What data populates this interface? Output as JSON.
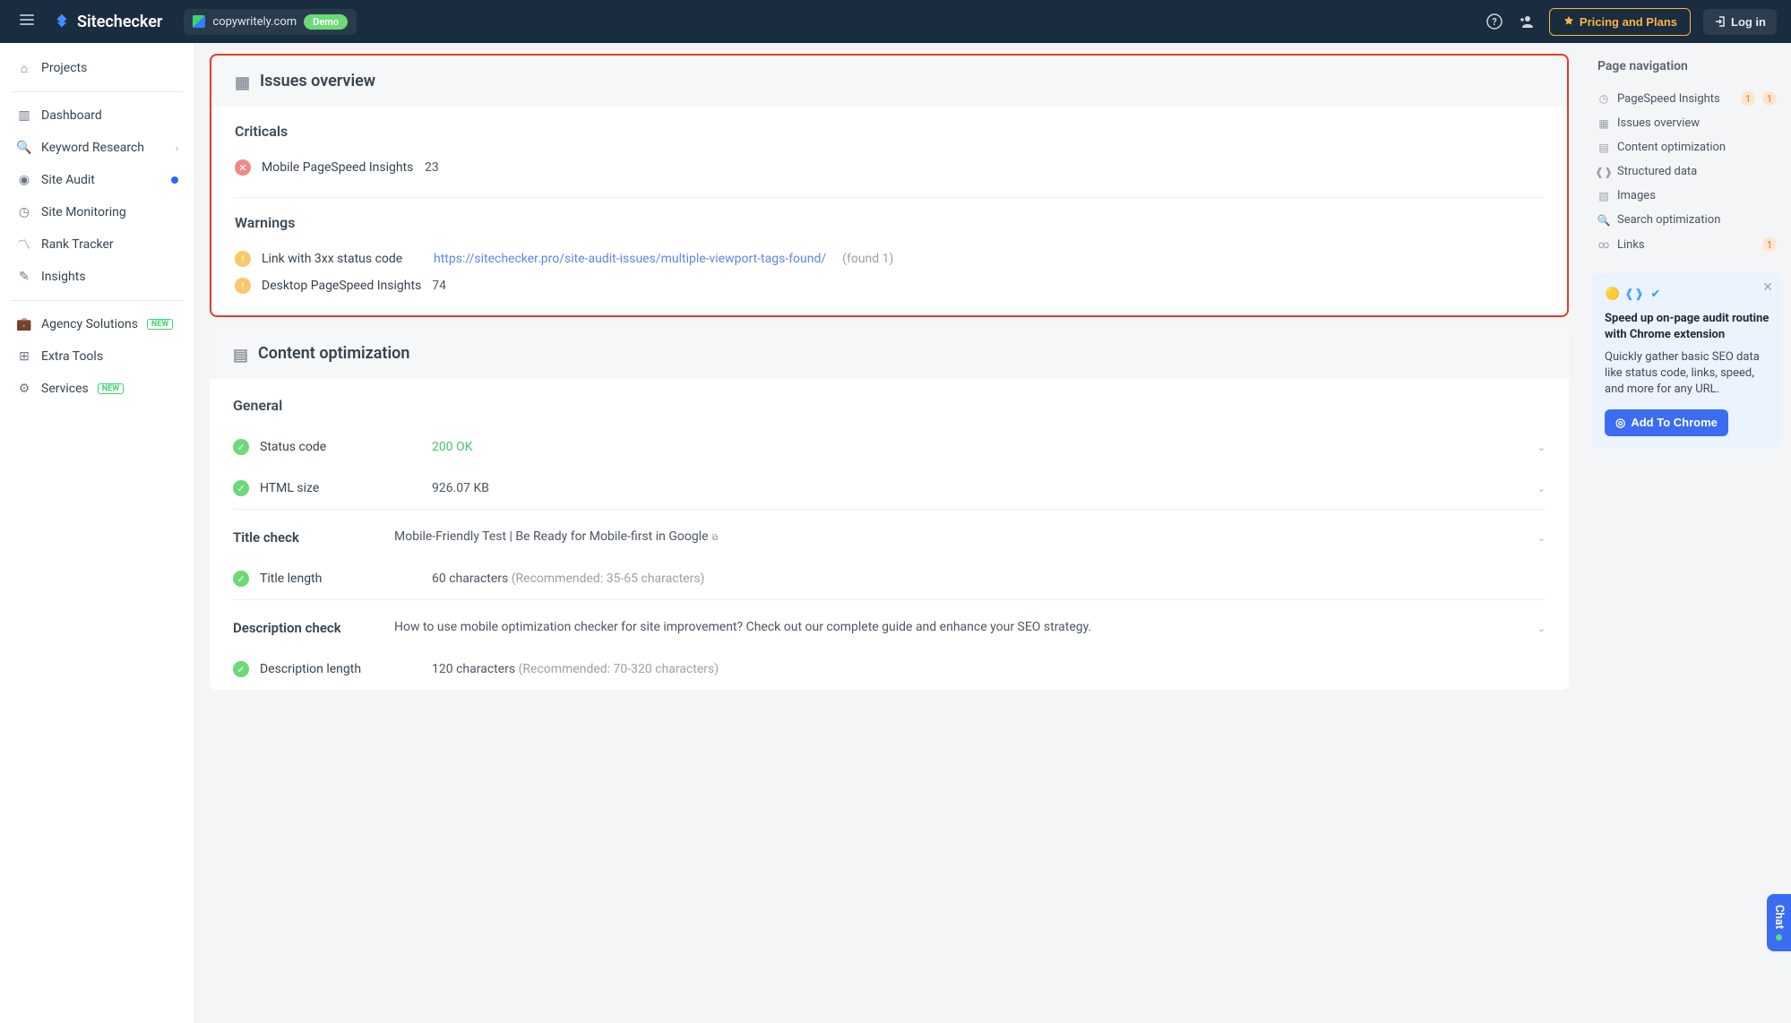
{
  "header": {
    "brand": "Sitechecker",
    "site": "copywritely.com",
    "demo": "Demo",
    "plans": "Pricing and Plans",
    "login": "Log in"
  },
  "sidebar": {
    "projects": "Projects",
    "dashboard": "Dashboard",
    "keyword_research": "Keyword Research",
    "site_audit": "Site Audit",
    "site_monitoring": "Site Monitoring",
    "rank_tracker": "Rank Tracker",
    "insights": "Insights",
    "agency": "Agency Solutions",
    "extra": "Extra Tools",
    "services": "Services",
    "new": "NEW"
  },
  "issues": {
    "title": "Issues overview",
    "criticals": "Criticals",
    "crit_label": "Mobile PageSpeed Insights",
    "crit_val": "23",
    "warnings": "Warnings",
    "w1_label": "Link with 3xx status code",
    "w1_link": "https://sitechecker.pro/site-audit-issues/multiple-viewport-tags-found/",
    "w1_found": "(found 1)",
    "w2_label": "Desktop PageSpeed Insights",
    "w2_val": "74"
  },
  "content": {
    "title": "Content optimization",
    "general": "General",
    "status_label": "Status code",
    "status_val": "200 OK",
    "html_label": "HTML size",
    "html_val": "926.07 KB",
    "title_check": "Title check",
    "title_check_val": "Mobile-Friendly Test | Be Ready for Mobile-first in Google",
    "title_len_label": "Title length",
    "title_len_val": "60 characters",
    "title_len_rec": "(Recommended: 35-65 characters)",
    "desc_check": "Description check",
    "desc_check_val": "How to use mobile optimization checker for site improvement? Check out our complete guide and enhance your SEO strategy.",
    "desc_len_label": "Description length",
    "desc_len_val": "120 characters",
    "desc_len_rec": "(Recommended: 70-320 characters)"
  },
  "rnav": {
    "title": "Page navigation",
    "items": {
      "psi": "PageSpeed Insights",
      "issues": "Issues overview",
      "content": "Content optimization",
      "structured": "Structured data",
      "images": "Images",
      "search": "Search optimization",
      "links": "Links"
    },
    "b1": "1",
    "b2": "1",
    "b3": "1"
  },
  "promo": {
    "title": "Speed up on-page audit routine with Chrome extension",
    "desc": "Quickly gather basic SEO data like status code, links, speed, and more for any URL.",
    "btn": "Add To Chrome"
  },
  "chat": "Chat"
}
